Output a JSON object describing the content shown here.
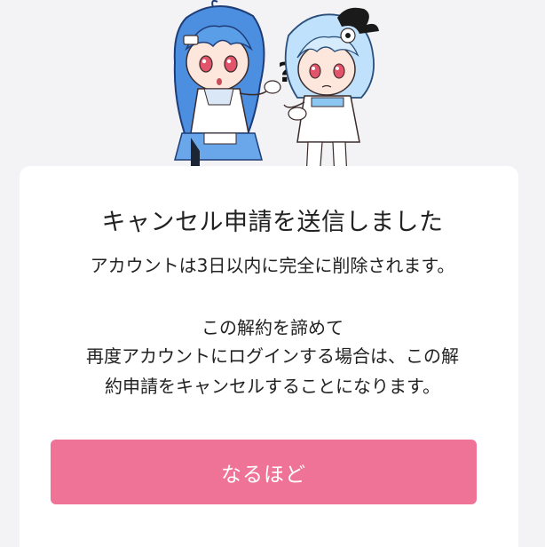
{
  "dialog": {
    "title": "キャンセル申請を送信しました",
    "message_line1": "アカウントは3日以内に完全に削除されます。",
    "message_line2": "この解約を諦めて",
    "message_line3": "再度アカウントにログインする場合は、この解",
    "message_line4": "約申請をキャンセルすることになります。",
    "ok_button_label": "なるほど"
  },
  "illustration": {
    "speech_mark": "?"
  },
  "colors": {
    "background": "#f3f3f5",
    "card": "#ffffff",
    "button": "#ee7396",
    "text": "#222222"
  }
}
